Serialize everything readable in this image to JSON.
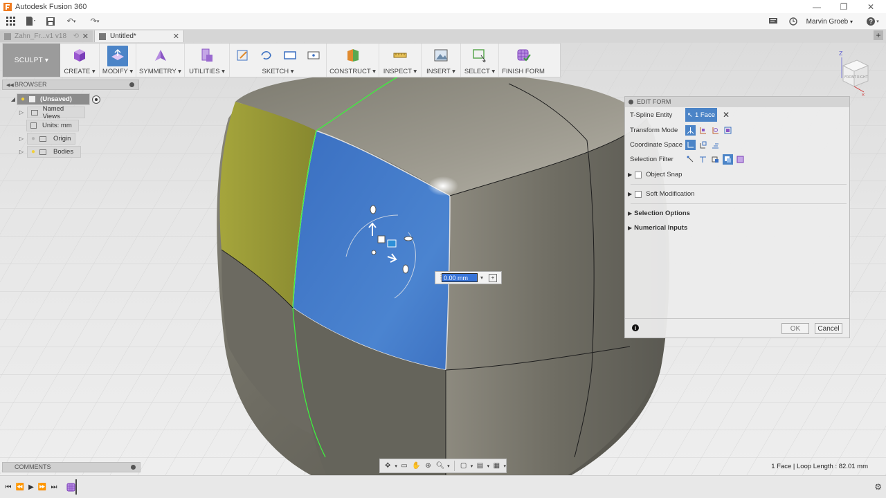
{
  "window": {
    "title": "Autodesk Fusion 360"
  },
  "appbar": {
    "user": "Marvin Groeb",
    "user_caret": "▾",
    "help": "?"
  },
  "tabs": [
    {
      "label": "Zahn_Fr...v1 v18"
    },
    {
      "label": "Untitled*"
    }
  ],
  "toolbar": {
    "workspace": "SCULPT ▾",
    "groups": {
      "create": "CREATE ▾",
      "modify": "MODIFY ▾",
      "symmetry": "SYMMETRY ▾",
      "utilities": "UTILITIES ▾",
      "sketch": "SKETCH ▾",
      "construct": "CONSTRUCT ▾",
      "inspect": "INSPECT ▾",
      "insert": "INSERT ▾",
      "select": "SELECT ▾",
      "finish": "FINISH FORM"
    }
  },
  "browser": {
    "header": "BROWSER",
    "items": [
      {
        "label": "(Unsaved)"
      },
      {
        "label": "Named Views"
      },
      {
        "label": "Units: mm"
      },
      {
        "label": "Origin"
      },
      {
        "label": "Bodies"
      }
    ]
  },
  "comments": {
    "header": "COMMENTS"
  },
  "edit_form": {
    "title": "EDIT FORM",
    "tspline_label": "T-Spline Entity",
    "tspline_value": "1 Face",
    "transform_mode_label": "Transform Mode",
    "coord_space_label": "Coordinate Space",
    "selection_filter_label": "Selection Filter",
    "object_snap": "Object Snap",
    "soft_mod": "Soft Modification",
    "selection_options": "Selection Options",
    "numerical_inputs": "Numerical Inputs",
    "ok": "OK",
    "cancel": "Cancel"
  },
  "distance_input": {
    "value": "0.00 mm"
  },
  "status": {
    "text": "1 Face | Loop Length : 82.01 mm"
  },
  "viewcube": {
    "axis_z": "Z",
    "front": "FRONT",
    "right": "RIGHT"
  },
  "colors": {
    "accent": "#4b84c7",
    "selected_face": "#3f74c4",
    "yellow_face": "#9a9a34",
    "body": "#6f6d63"
  }
}
